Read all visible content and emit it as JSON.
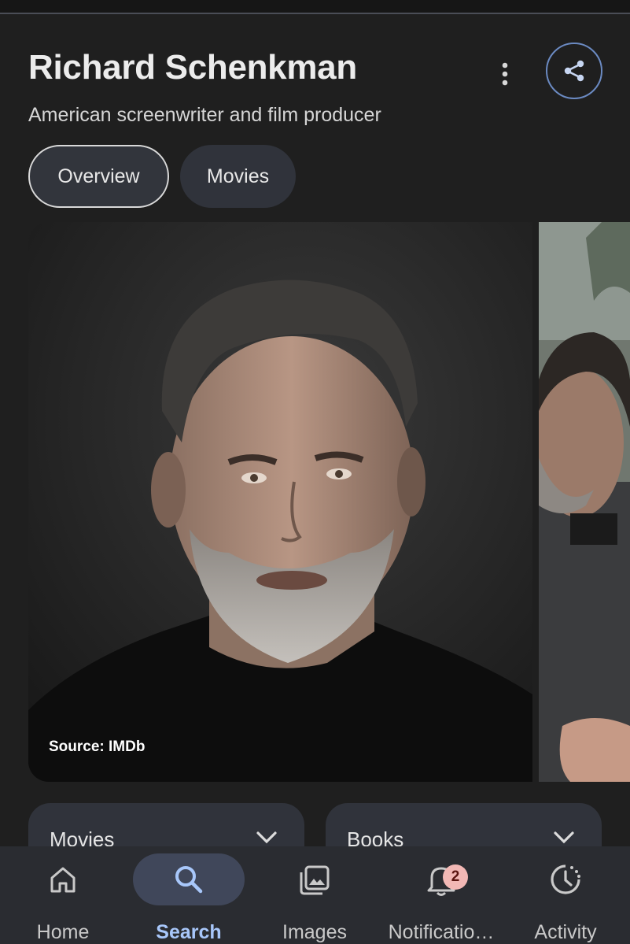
{
  "entity": {
    "title": "Richard Schenkman",
    "subtitle": "American screenwriter and film producer"
  },
  "tabs": [
    {
      "label": "Overview",
      "selected": true
    },
    {
      "label": "Movies",
      "selected": false
    }
  ],
  "images": {
    "main_source": "Source: IMDb"
  },
  "cards": [
    {
      "label": "Movies"
    },
    {
      "label": "Books"
    }
  ],
  "bottom_nav": [
    {
      "label": "Home",
      "icon": "home-icon",
      "active": false
    },
    {
      "label": "Search",
      "icon": "search-icon",
      "active": true
    },
    {
      "label": "Images",
      "icon": "images-icon",
      "active": false
    },
    {
      "label": "Notificatio…",
      "icon": "bell-icon",
      "active": false,
      "badge": "2"
    },
    {
      "label": "Activity",
      "icon": "activity-icon",
      "active": false
    }
  ],
  "colors": {
    "background": "#1f1f1f",
    "chip": "#30333b",
    "accent": "#a8c7fa",
    "badge": "#f2b8b5"
  }
}
